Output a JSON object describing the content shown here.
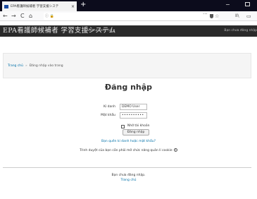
{
  "browser": {
    "tab_title": "EPA看護師候補者 学習支援システ",
    "tab_close": "×",
    "new_tab": "+",
    "minimize": "−",
    "nav": {
      "back": "←",
      "forward": "→",
      "reload": "C",
      "home": "⌂"
    },
    "url_left": "ⓘ 🔒",
    "url_menu": "···",
    "bookmark_star": "☆",
    "library": "II\\",
    "sidebar_toggle": "▭"
  },
  "site": {
    "title": "EPA看護師候補者 学習支援システム",
    "language": "Vietnamese (vi) ▾",
    "not_logged_in": "Bạn chưa đăng nhập"
  },
  "breadcrumb": {
    "home": "Trang chủ",
    "separator": "»",
    "current": "Đăng nhập vào trang"
  },
  "login": {
    "title": "Đăng nhập",
    "username_label": "Kí danh",
    "username_value": "DEMO User",
    "password_label": "Mật khẩu",
    "password_value": "••••••••••",
    "remember_label": "Nhớ tài khoản",
    "submit_label": "Đăng nhập",
    "forgot_link": "Bạn quên kí danh hoặc mật khẩu?",
    "cookies_notice": "Trình duyệt của bạn cần phải mở chức năng quản lí cookie",
    "help_icon": "?"
  },
  "footer": {
    "status": "Bạn chưa đăng nhập.",
    "home_link": "Trang chủ"
  }
}
